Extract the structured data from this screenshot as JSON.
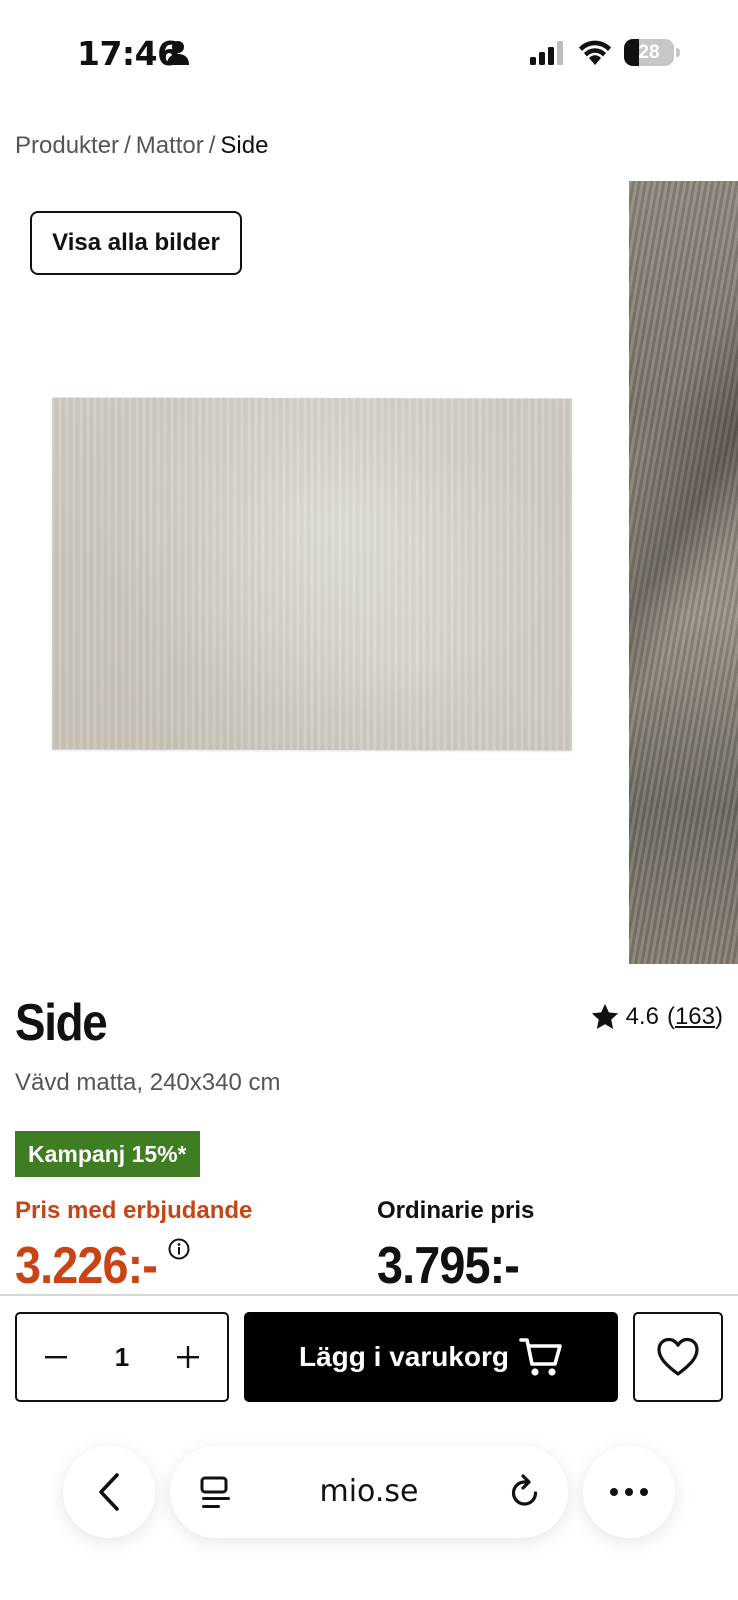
{
  "status_bar": {
    "time": "17:46",
    "battery": "28"
  },
  "breadcrumb": {
    "items": [
      "Produkter",
      "Mattor"
    ],
    "current": "Side",
    "separator": "/"
  },
  "gallery": {
    "show_all_label": "Visa alla bilder"
  },
  "product": {
    "title": "Side",
    "subtitle": "Vävd matta, 240x340 cm",
    "rating": "4.6",
    "review_count": "163",
    "review_open": "(",
    "review_close": ")",
    "campaign_badge": "Kampanj 15%*"
  },
  "pricing": {
    "offer_label": "Pris med erbjudande",
    "offer_price": "3.226:-",
    "regular_label": "Ordinarie pris",
    "regular_price": "3.795:-"
  },
  "purchase": {
    "quantity": "1",
    "add_to_cart_label": "Lägg i varukorg"
  },
  "browser": {
    "url": "mio.se"
  },
  "colors": {
    "offer": "#c84414",
    "campaign_badge": "#3f7d22",
    "button": "#000000"
  }
}
